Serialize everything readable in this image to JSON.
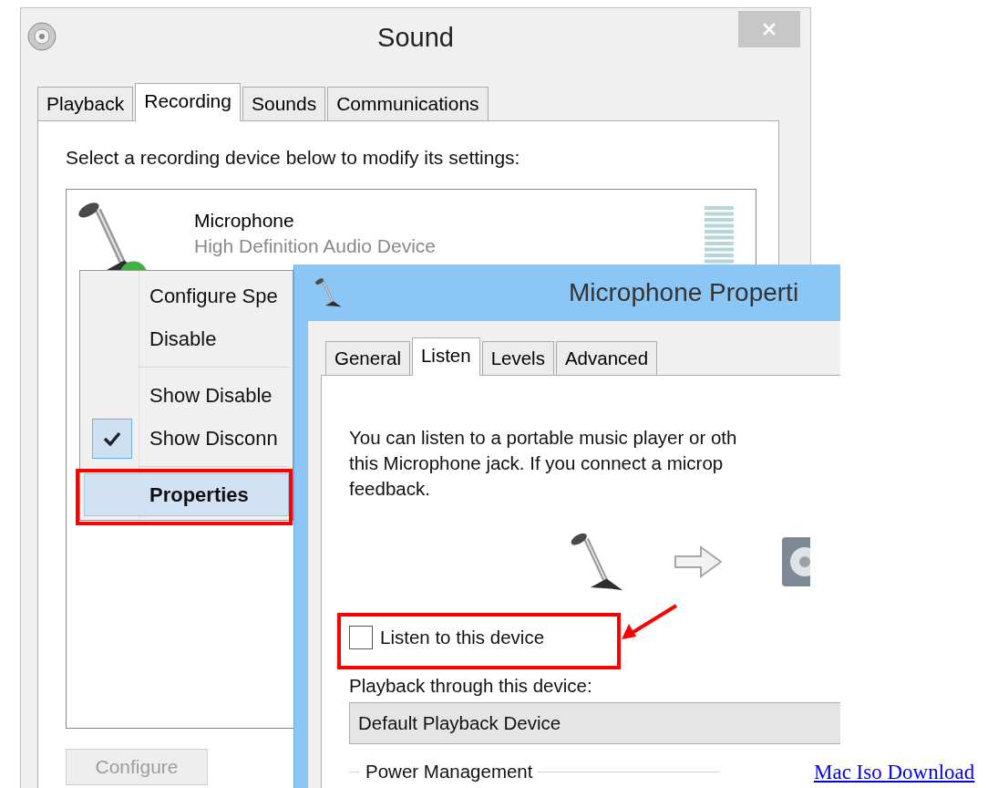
{
  "sound_window": {
    "title": "Sound",
    "tabs": [
      {
        "label": "Playback",
        "selected": false
      },
      {
        "label": "Recording",
        "selected": true
      },
      {
        "label": "Sounds",
        "selected": false
      },
      {
        "label": "Communications",
        "selected": false
      }
    ],
    "instruction": "Select a recording device below to modify its settings:",
    "devices": [
      {
        "name": "Microphone",
        "description": "High Definition Audio Device"
      }
    ],
    "buttons": [
      {
        "label": "Configure",
        "disabled": true
      }
    ]
  },
  "context_menu": {
    "groups": [
      {
        "items": [
          {
            "label": "Configure Spe",
            "checked": false,
            "selected": false,
            "default": false
          },
          {
            "label": "Disable",
            "checked": false,
            "selected": false,
            "default": false
          }
        ]
      },
      {
        "items": [
          {
            "label": "Show Disable",
            "checked": false,
            "selected": false,
            "default": false
          },
          {
            "label": "Show Disconn",
            "checked": true,
            "selected": false,
            "default": false
          }
        ]
      },
      {
        "items": [
          {
            "label": "Properties",
            "checked": false,
            "selected": true,
            "default": true
          }
        ]
      }
    ]
  },
  "properties_window": {
    "title": "Microphone Properti",
    "tabs": [
      {
        "label": "General",
        "selected": false
      },
      {
        "label": "Listen",
        "selected": true
      },
      {
        "label": "Levels",
        "selected": false
      },
      {
        "label": "Advanced",
        "selected": false
      }
    ],
    "description": "You can listen to a portable music player or oth\nthis Microphone jack.  If you connect a microp\nfeedback.",
    "listen_checkbox": {
      "label": "Listen to this device",
      "checked": false
    },
    "playback_label": "Playback through this device:",
    "playback_dropdown": {
      "value": "Default Playback Device"
    },
    "group_label": "Power Management"
  },
  "page_link": "Mac Iso Download"
}
